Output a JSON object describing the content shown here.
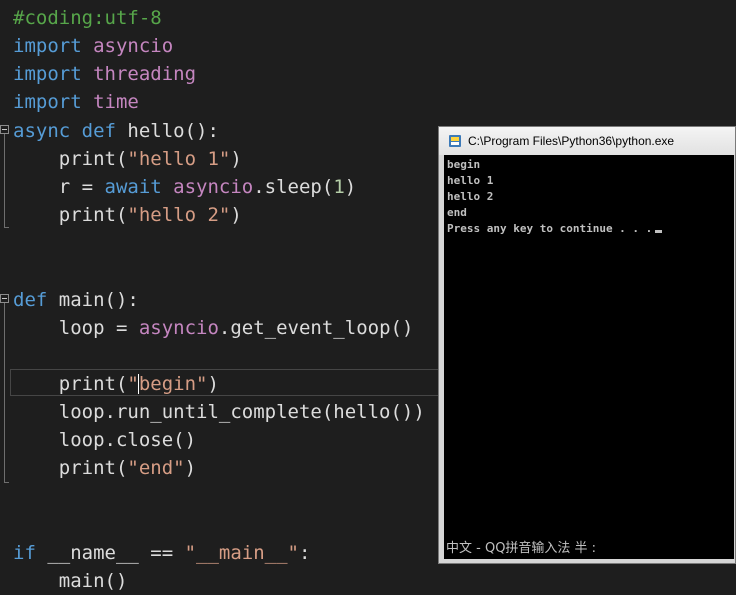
{
  "editor": {
    "lines": [
      {
        "tokens": [
          {
            "t": "#coding:utf-8",
            "c": "cmt"
          }
        ]
      },
      {
        "tokens": [
          {
            "t": "import ",
            "c": "kw"
          },
          {
            "t": "asyncio",
            "c": "mod"
          }
        ]
      },
      {
        "tokens": [
          {
            "t": "import ",
            "c": "kw"
          },
          {
            "t": "threading",
            "c": "mod"
          }
        ]
      },
      {
        "tokens": [
          {
            "t": "import ",
            "c": "kw"
          },
          {
            "t": "time",
            "c": "mod"
          }
        ]
      },
      {
        "tokens": [
          {
            "t": "async ",
            "c": "kw"
          },
          {
            "t": "def ",
            "c": "kw"
          },
          {
            "t": "hello():",
            "c": "plain"
          }
        ]
      },
      {
        "tokens": [
          {
            "t": "    print(",
            "c": "plain"
          },
          {
            "t": "\"hello 1\"",
            "c": "str"
          },
          {
            "t": ")",
            "c": "plain"
          }
        ]
      },
      {
        "tokens": [
          {
            "t": "    r = ",
            "c": "plain"
          },
          {
            "t": "await ",
            "c": "kw"
          },
          {
            "t": "asyncio",
            "c": "mod"
          },
          {
            "t": ".sleep(",
            "c": "plain"
          },
          {
            "t": "1",
            "c": "num"
          },
          {
            "t": ")",
            "c": "plain"
          }
        ]
      },
      {
        "tokens": [
          {
            "t": "    print(",
            "c": "plain"
          },
          {
            "t": "\"hello 2\"",
            "c": "str"
          },
          {
            "t": ")",
            "c": "plain"
          }
        ]
      },
      {
        "tokens": []
      },
      {
        "tokens": []
      },
      {
        "tokens": [
          {
            "t": "def ",
            "c": "kw"
          },
          {
            "t": "main():",
            "c": "plain"
          }
        ]
      },
      {
        "tokens": [
          {
            "t": "    loop = ",
            "c": "plain"
          },
          {
            "t": "asyncio",
            "c": "mod"
          },
          {
            "t": ".get_event_loop()",
            "c": "plain"
          }
        ]
      },
      {
        "tokens": []
      },
      {
        "tokens": [
          {
            "t": "    print(",
            "c": "plain"
          },
          {
            "t": "\"begin\"",
            "c": "str"
          },
          {
            "t": ")",
            "c": "plain"
          }
        ]
      },
      {
        "tokens": [
          {
            "t": "    loop.run_until_complete(hello())",
            "c": "plain"
          }
        ]
      },
      {
        "tokens": [
          {
            "t": "    loop.close()",
            "c": "plain"
          }
        ]
      },
      {
        "tokens": [
          {
            "t": "    print(",
            "c": "plain"
          },
          {
            "t": "\"end\"",
            "c": "str"
          },
          {
            "t": ")",
            "c": "plain"
          }
        ]
      },
      {
        "tokens": []
      },
      {
        "tokens": []
      },
      {
        "tokens": [
          {
            "t": "if ",
            "c": "kw"
          },
          {
            "t": "__name__ == ",
            "c": "plain"
          },
          {
            "t": "\"__main__\"",
            "c": "str"
          },
          {
            "t": ":",
            "c": "plain"
          }
        ]
      },
      {
        "tokens": [
          {
            "t": "    main()",
            "c": "plain"
          }
        ]
      }
    ]
  },
  "console": {
    "title": "C:\\Program Files\\Python36\\python.exe",
    "icon": "python-icon",
    "output": [
      "begin",
      "hello 1",
      "hello 2",
      "end",
      "Press any key to continue . . ."
    ],
    "ime_status": "中文 - QQ拼音输入法 半 :"
  }
}
